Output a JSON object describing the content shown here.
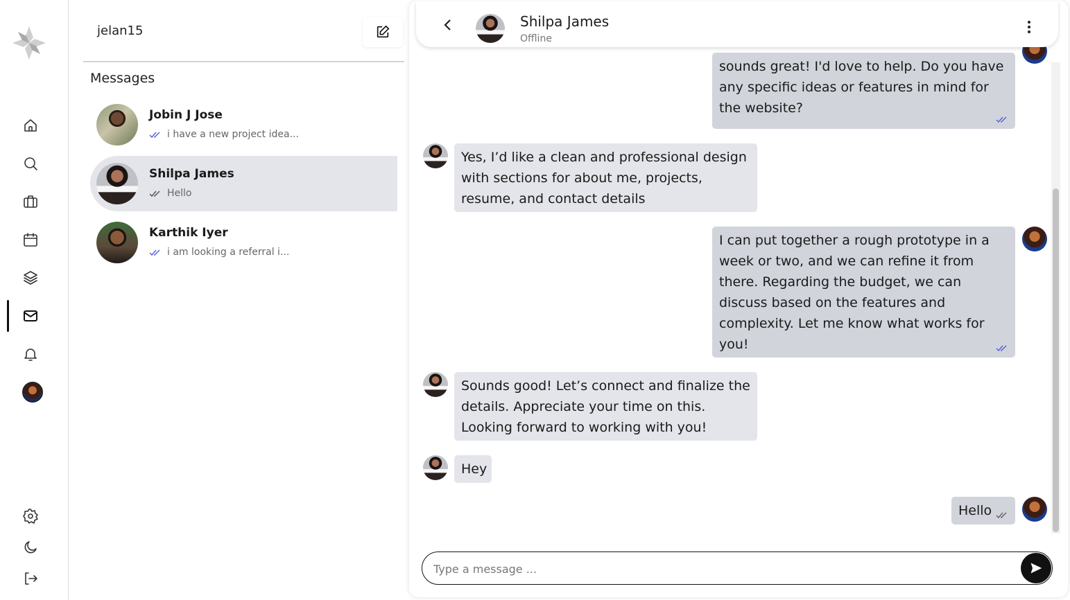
{
  "sidebar": {
    "icons": [
      "logo-icon",
      "home-icon",
      "search-icon",
      "briefcase-icon",
      "calendar-icon",
      "layers-icon",
      "mail-icon",
      "bell-icon",
      "avatar",
      "gear-icon",
      "moon-icon",
      "logout-icon"
    ],
    "active_item": "mail-icon"
  },
  "conversations_panel": {
    "username": "jelan15",
    "section_title": "Messages",
    "conversations": [
      {
        "name": "Jobin J Jose",
        "preview": "i have a new project idea...",
        "read_color": "#5b63d6"
      },
      {
        "name": "Shilpa James",
        "preview": "Hello",
        "read_color": "#555555"
      },
      {
        "name": "Karthik Iyer",
        "preview": "i am looking a referral i...",
        "read_color": "#5b63d6"
      }
    ]
  },
  "chat": {
    "contact_name": "Shilpa James",
    "contact_status": "Offline",
    "messages": [
      {
        "direction": "out",
        "text": "sounds great! I'd love to help. Do you have any specific ideas or features in mind for the website?"
      },
      {
        "direction": "in",
        "text": "Yes, I’d like a clean and professional design with sections for about me, projects, resume, and contact details"
      },
      {
        "direction": "out",
        "text": "I can put together a rough prototype in a week or two, and we can refine it from there. Regarding the budget, we can discuss based on the features and complexity. Let me know what works for you!"
      },
      {
        "direction": "in",
        "text": "Sounds good! Let’s connect and finalize the details. Appreciate your time on this. Looking forward to working with you!"
      },
      {
        "direction": "in",
        "text": "Hey"
      },
      {
        "direction": "out",
        "text": "Hello"
      }
    ],
    "composer_placeholder": "Type a message ..."
  },
  "colors": {
    "selected_row": "#e4e5ea",
    "incoming_bubble": "#e4e5ea",
    "outgoing_bubble": "#d2d4dc",
    "read_tick": "#5b63d6",
    "send_button": "#111111"
  }
}
